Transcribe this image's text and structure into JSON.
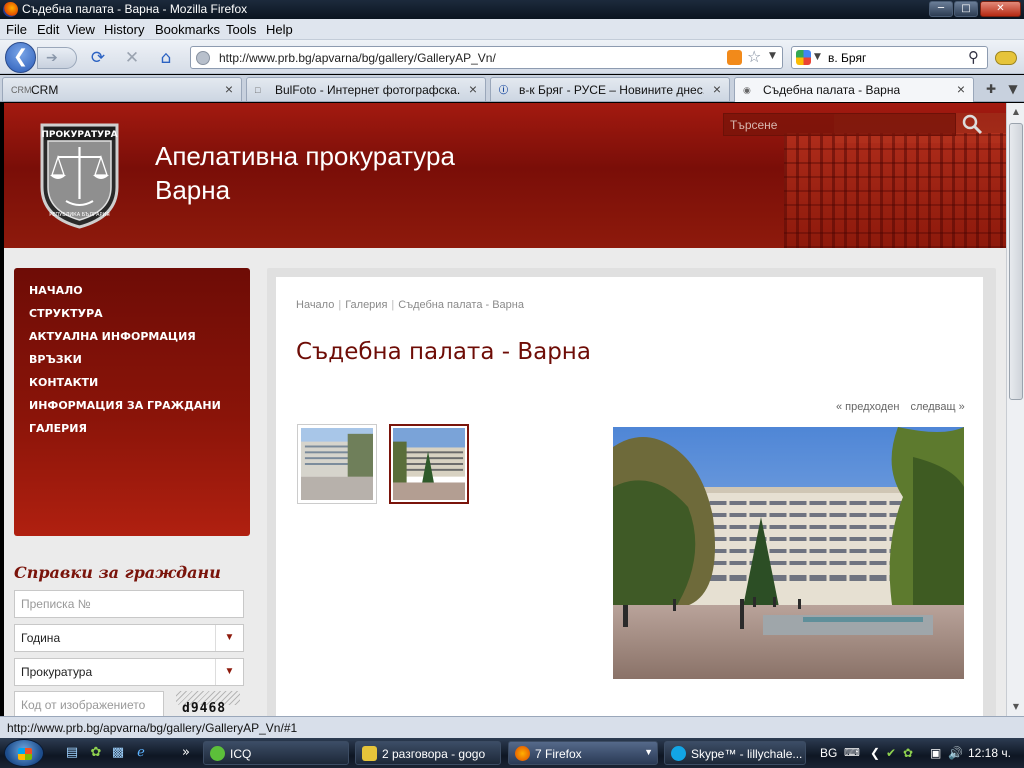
{
  "window": {
    "title": "Съдебна палата - Варна - Mozilla Firefox"
  },
  "menu": [
    "File",
    "Edit",
    "View",
    "History",
    "Bookmarks",
    "Tools",
    "Help"
  ],
  "urlbar": {
    "url": "http://www.prb.bg/apvarna/bg/gallery/GalleryAP_Vn/"
  },
  "searchbar": {
    "value": "в. Бряг"
  },
  "tabs": [
    {
      "label": "CRM",
      "icon": "CRM"
    },
    {
      "label": "BulFoto - Интернет фотографска...",
      "icon": "doc"
    },
    {
      "label": "в-к Бряг - РУСЕ – Новините днес....",
      "icon": "i"
    },
    {
      "label": "Съдебна палата - Варна",
      "icon": "site"
    }
  ],
  "site": {
    "title_line1": "Апелативна прокуратура",
    "title_line2": "Варна",
    "search_placeholder": "Търсене",
    "emblem_text": "ПРОКУРАТУРА",
    "emblem_bottom": "РЕПУБЛИКА БЪЛГАРИЯ"
  },
  "sidebar": {
    "menu": [
      "НАЧАЛО",
      "СТРУКТУРА",
      "АКТУАЛНА ИНФОРМАЦИЯ",
      "ВРЪЗКИ",
      "КОНТАКТИ",
      "ИНФОРМАЦИЯ ЗА ГРАЖДАНИ",
      "ГАЛЕРИЯ"
    ],
    "heading": "Справки за граждани",
    "fields": {
      "case_placeholder": "Преписка №",
      "year_label": "Година",
      "office_label": "Прокуратура",
      "captcha_placeholder": "Код от изображението",
      "captcha_code": "d9468"
    }
  },
  "content": {
    "breadcrumb": [
      "Начало",
      "Галерия",
      "Съдебна палата - Варна"
    ],
    "title": "Съдебна палата - Варна",
    "prev": "« предходен",
    "next": "следващ »"
  },
  "status": {
    "text": "http://www.prb.bg/apvarna/bg/gallery/GalleryAP_Vn/#1"
  },
  "taskbar": {
    "items": [
      "ICQ",
      "2 разговора - gogo",
      "7 Firefox",
      "Skype™ - lillychale..."
    ],
    "lang": "BG",
    "clock": "12:18 ч."
  }
}
